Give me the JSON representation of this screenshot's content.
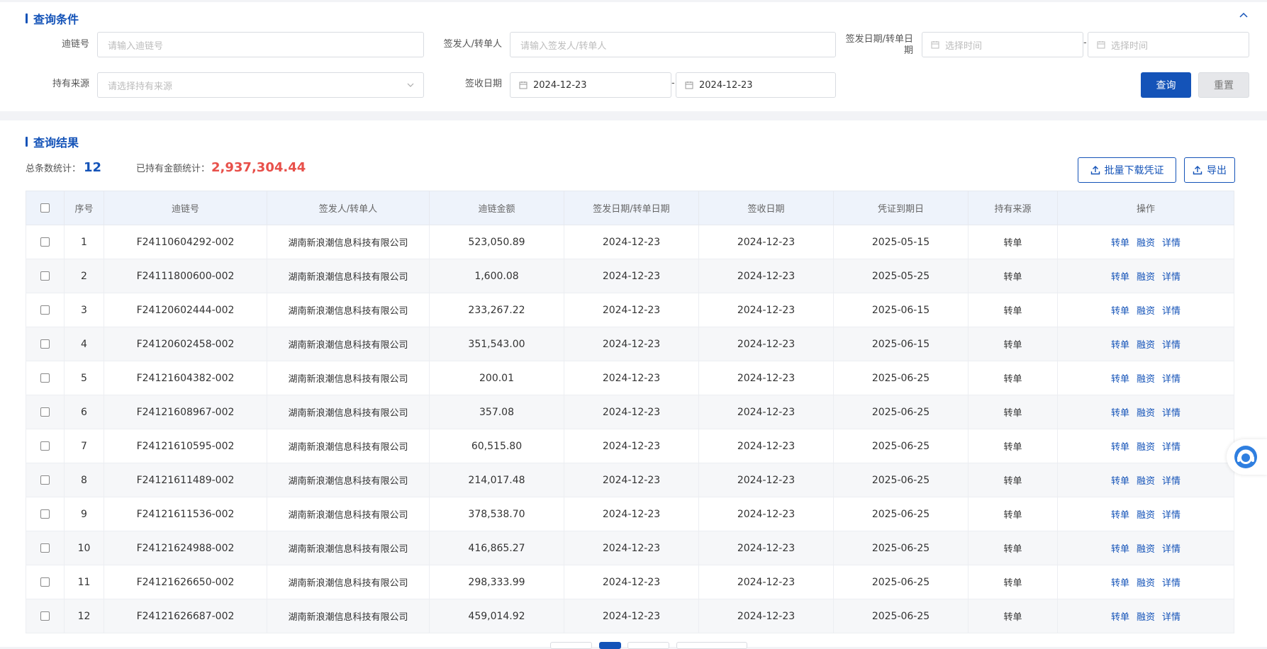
{
  "query": {
    "title": "查询条件",
    "fields": {
      "chain_no_label": "迪链号",
      "chain_no_placeholder": "请输入迪链号",
      "signer_label": "签发人/转单人",
      "signer_placeholder": "请输入签发人/转单人",
      "issue_date_label_1": "签发日期/转单日",
      "issue_date_label_2": "期",
      "issue_start_placeholder": "选择时间",
      "issue_end_placeholder": "选择时间",
      "source_label": "持有来源",
      "source_placeholder": "请选择持有来源",
      "receive_date_label": "签收日期",
      "receive_start": "2024-12-23",
      "receive_end": "2024-12-23",
      "dash": "-"
    },
    "search_button": "查询",
    "reset_button": "重置"
  },
  "results": {
    "title": "查询结果",
    "total_label": "总条数统计：",
    "total_value": "12",
    "amount_label": "已持有金额统计：",
    "amount_value": "2,937,304.44",
    "batch_download_button": "批量下载凭证",
    "export_button": "导出",
    "columns": [
      "序号",
      "迪链号",
      "签发人/转单人",
      "迪链金额",
      "签发日期/转单日期",
      "签收日期",
      "凭证到期日",
      "持有来源",
      "操作"
    ],
    "actions": [
      "转单",
      "融资",
      "详情"
    ],
    "rows": [
      {
        "no": "1",
        "chain": "F24110604292-002",
        "drawer": "湖南新浪潮信息科技有限公司",
        "amount": "523,050.89",
        "issue": "2024-12-23",
        "receive": "2024-12-23",
        "due": "2025-05-15",
        "source": "转单"
      },
      {
        "no": "2",
        "chain": "F24111800600-002",
        "drawer": "湖南新浪潮信息科技有限公司",
        "amount": "1,600.08",
        "issue": "2024-12-23",
        "receive": "2024-12-23",
        "due": "2025-05-25",
        "source": "转单"
      },
      {
        "no": "3",
        "chain": "F24120602444-002",
        "drawer": "湖南新浪潮信息科技有限公司",
        "amount": "233,267.22",
        "issue": "2024-12-23",
        "receive": "2024-12-23",
        "due": "2025-06-15",
        "source": "转单"
      },
      {
        "no": "4",
        "chain": "F24120602458-002",
        "drawer": "湖南新浪潮信息科技有限公司",
        "amount": "351,543.00",
        "issue": "2024-12-23",
        "receive": "2024-12-23",
        "due": "2025-06-15",
        "source": "转单"
      },
      {
        "no": "5",
        "chain": "F24121604382-002",
        "drawer": "湖南新浪潮信息科技有限公司",
        "amount": "200.01",
        "issue": "2024-12-23",
        "receive": "2024-12-23",
        "due": "2025-06-25",
        "source": "转单"
      },
      {
        "no": "6",
        "chain": "F24121608967-002",
        "drawer": "湖南新浪潮信息科技有限公司",
        "amount": "357.08",
        "issue": "2024-12-23",
        "receive": "2024-12-23",
        "due": "2025-06-25",
        "source": "转单"
      },
      {
        "no": "7",
        "chain": "F24121610595-002",
        "drawer": "湖南新浪潮信息科技有限公司",
        "amount": "60,515.80",
        "issue": "2024-12-23",
        "receive": "2024-12-23",
        "due": "2025-06-25",
        "source": "转单"
      },
      {
        "no": "8",
        "chain": "F24121611489-002",
        "drawer": "湖南新浪潮信息科技有限公司",
        "amount": "214,017.48",
        "issue": "2024-12-23",
        "receive": "2024-12-23",
        "due": "2025-06-25",
        "source": "转单"
      },
      {
        "no": "9",
        "chain": "F24121611536-002",
        "drawer": "湖南新浪潮信息科技有限公司",
        "amount": "378,538.70",
        "issue": "2024-12-23",
        "receive": "2024-12-23",
        "due": "2025-06-25",
        "source": "转单"
      },
      {
        "no": "10",
        "chain": "F24121624988-002",
        "drawer": "湖南新浪潮信息科技有限公司",
        "amount": "416,865.27",
        "issue": "2024-12-23",
        "receive": "2024-12-23",
        "due": "2025-06-25",
        "source": "转单"
      },
      {
        "no": "11",
        "chain": "F24121626650-002",
        "drawer": "湖南新浪潮信息科技有限公司",
        "amount": "298,333.99",
        "issue": "2024-12-23",
        "receive": "2024-12-23",
        "due": "2025-06-25",
        "source": "转单"
      },
      {
        "no": "12",
        "chain": "F24121626687-002",
        "drawer": "湖南新浪潮信息科技有限公司",
        "amount": "459,014.92",
        "issue": "2024-12-23",
        "receive": "2024-12-23",
        "due": "2025-06-25",
        "source": "转单"
      }
    ]
  },
  "icons": {
    "collapse": "chevron-up-icon",
    "calendar": "calendar-icon",
    "dropdown": "chevron-down-icon",
    "upload": "upload-icon",
    "help": "customer-service-icon"
  },
  "colors": {
    "primary": "#1453b8",
    "amount_red": "#e8504a",
    "header_bg": "#eef3fb"
  }
}
